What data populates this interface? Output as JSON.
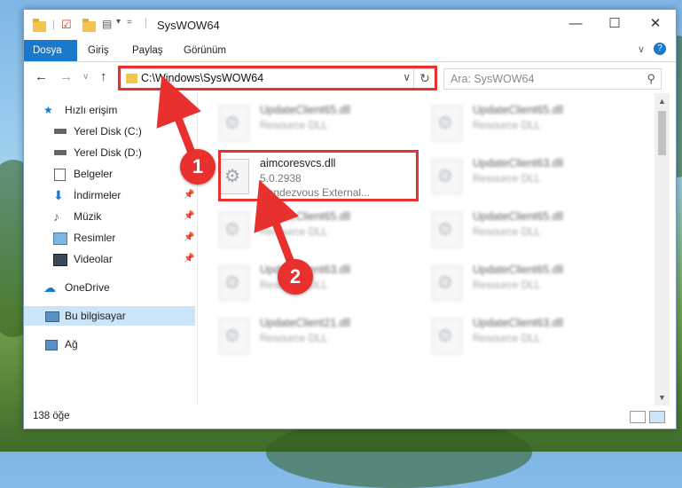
{
  "window": {
    "title": "SysWOW64"
  },
  "ribbon": {
    "tabs": [
      "Dosya",
      "Giriş",
      "Paylaş",
      "Görünüm"
    ]
  },
  "address": {
    "path": "C:\\Windows\\SysWOW64",
    "search_placeholder": "Ara: SysWOW64"
  },
  "sidebar": {
    "items": [
      {
        "label": "Hızlı erişim",
        "icon": "star-icon"
      },
      {
        "label": "Yerel Disk (C:)",
        "icon": "drive-icon"
      },
      {
        "label": "Yerel Disk (D:)",
        "icon": "drive-icon"
      },
      {
        "label": "Belgeler",
        "icon": "documents-icon"
      },
      {
        "label": "İndirmeler",
        "icon": "downloads-icon"
      },
      {
        "label": "Müzik",
        "icon": "music-icon"
      },
      {
        "label": "Resimler",
        "icon": "pictures-icon"
      },
      {
        "label": "Videolar",
        "icon": "videos-icon"
      },
      {
        "label": "OneDrive",
        "icon": "cloud-icon"
      },
      {
        "label": "Bu bilgisayar",
        "icon": "computer-icon"
      },
      {
        "label": "Ağ",
        "icon": "network-icon"
      }
    ]
  },
  "files": [
    {
      "name": "UpdateClient65.dll",
      "type": "Resource DLL"
    },
    {
      "name": "UpdateClient65.dll",
      "type": "Resource DLL"
    },
    {
      "name": "aimcoresvcs.dll",
      "version": "5.0.2938",
      "desc": "Rendezvous External..."
    },
    {
      "name": "UpdateClient63.dll",
      "type": "Resource DLL"
    },
    {
      "name": "UpdateClient65.dll",
      "type": "Resource DLL"
    },
    {
      "name": "UpdateClient65.dll",
      "type": "Resource DLL"
    },
    {
      "name": "UpdateClient63.dll",
      "type": "Resource DLL"
    },
    {
      "name": "UpdateClient65.dll",
      "type": "Resource DLL"
    },
    {
      "name": "UpdateClient21.dll",
      "type": "Resource DLL"
    },
    {
      "name": "UpdateClient63.dll",
      "type": "Resource DLL"
    }
  ],
  "status": {
    "count": "138 öğe"
  },
  "markers": [
    "1",
    "2"
  ],
  "colors": {
    "accent": "#1979ca",
    "highlight": "#e8302e"
  }
}
